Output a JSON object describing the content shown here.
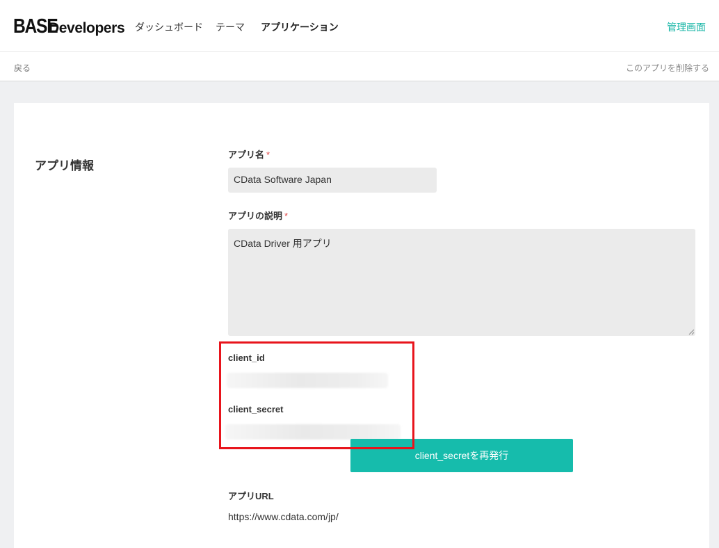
{
  "header": {
    "logo_base": "BASE",
    "logo_developers": "Developers",
    "nav": [
      "ダッシュボード",
      "テーマ",
      "アプリケーション"
    ],
    "active_nav": "アプリケーション",
    "admin_link": "管理画面"
  },
  "subbar": {
    "back": "戻る",
    "delete": "このアプリを削除する"
  },
  "app_info": {
    "section_title": "アプリ情報",
    "required_mark": "*",
    "name_label": "アプリ名",
    "name_value": "CData Software Japan",
    "description_label": "アプリの説明",
    "description_value": "CData Driver 用アプリ",
    "client_id_label": "client_id",
    "client_secret_label": "client_secret",
    "regenerate_button": "client_secretを再発行",
    "url_label": "アプリURL",
    "url_value": "https://www.cdata.com/jp/"
  },
  "colors": {
    "accent": "#16bcac",
    "highlight_box": "#e8141c",
    "required": "#e04848"
  }
}
